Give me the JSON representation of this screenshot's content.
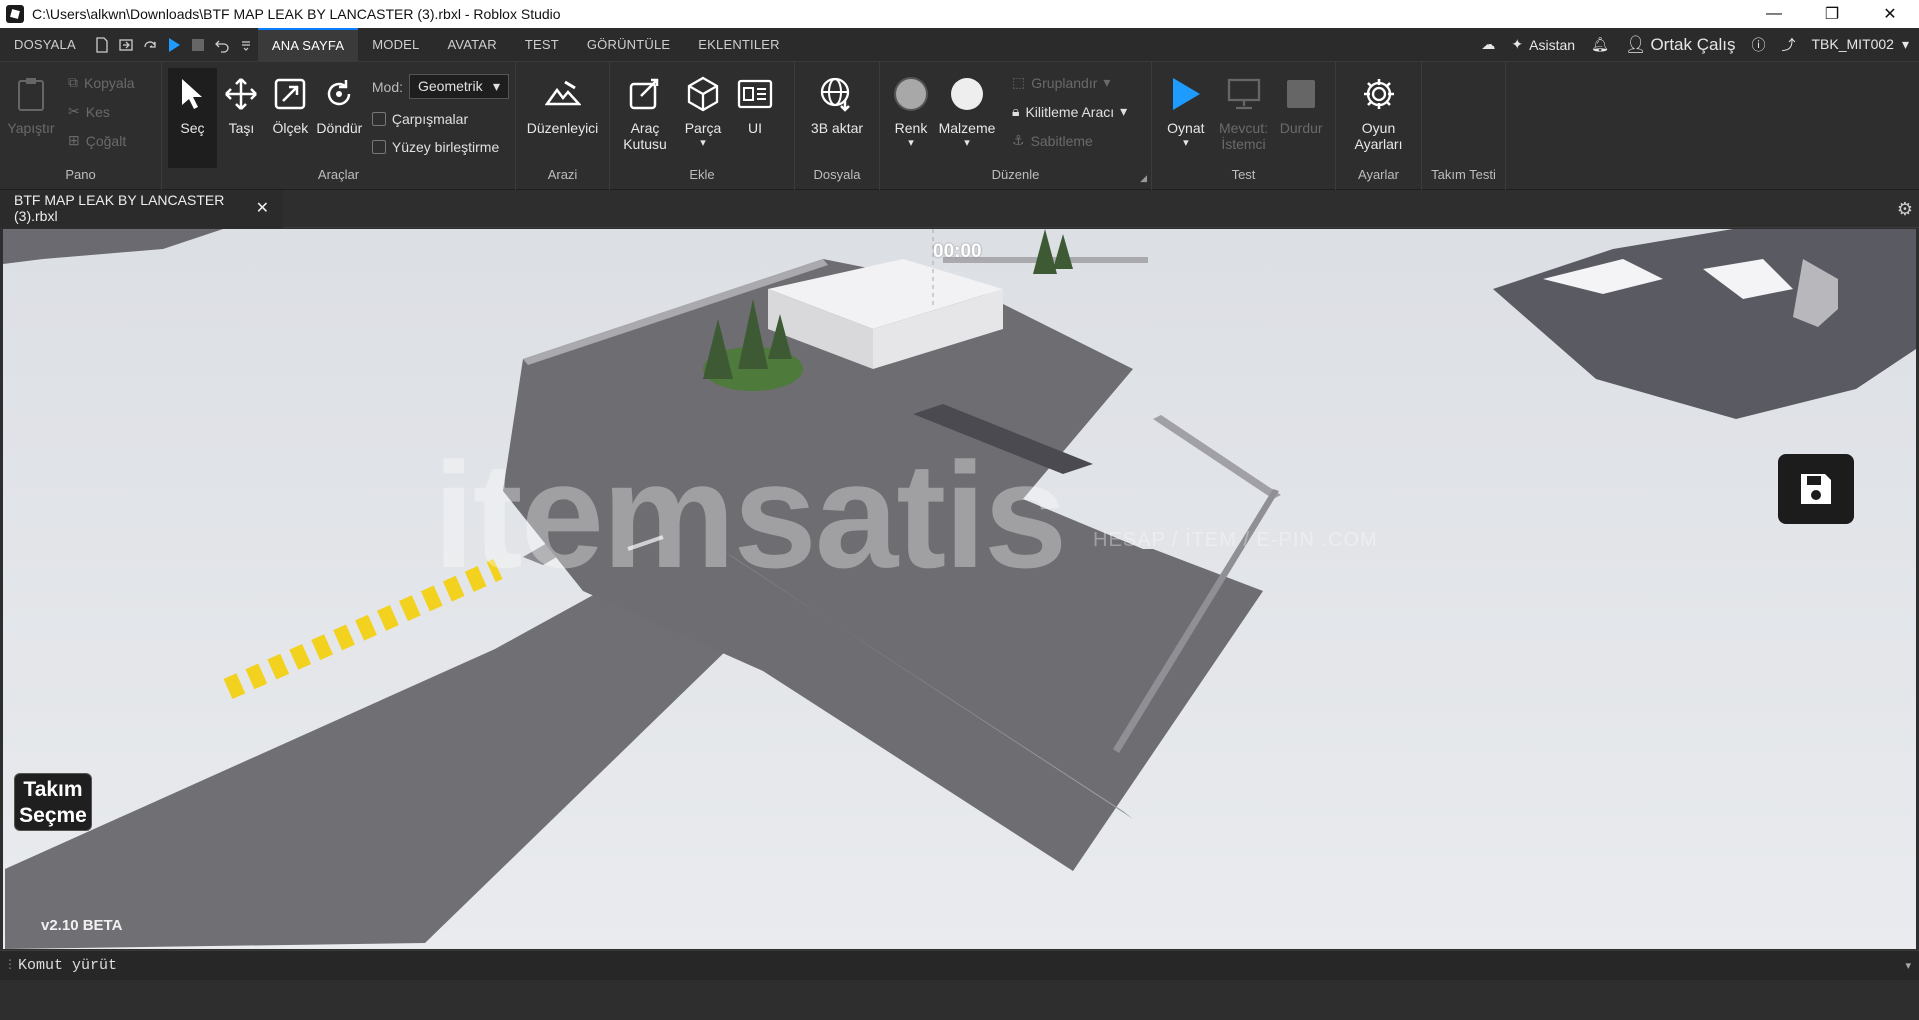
{
  "window": {
    "title": "C:\\Users\\alkwn\\Downloads\\BTF MAP LEAK BY LANCASTER (3).rbxl - Roblox Studio",
    "minimize": "—",
    "maximize": "❐",
    "close": "✕"
  },
  "menubar": {
    "file_label": "DOSYALA",
    "tabs": [
      "ANA SAYFA",
      "MODEL",
      "AVATAR",
      "TEST",
      "GÖRÜNTÜLE",
      "EKLENTILER"
    ],
    "assistant": "Asistan",
    "collab": "Ortak Çalış",
    "user": "TBK_MIT002"
  },
  "ribbon": {
    "clipboard": {
      "paste": "Yapıştır",
      "copy": "Kopyala",
      "cut": "Kes",
      "duplicate": "Çoğalt",
      "label": "Pano"
    },
    "tools": {
      "select": "Seç",
      "move": "Taşı",
      "scale": "Ölçek",
      "rotate": "Döndür",
      "mode_label": "Mod:",
      "mode_value": "Geometrik",
      "collisions": "Çarpışmalar",
      "join_surfaces": "Yüzey birleştirme",
      "label": "Araçlar"
    },
    "terrain": {
      "editor": "Düzenleyici",
      "label": "Arazi"
    },
    "insert": {
      "toolbox_line1": "Araç",
      "toolbox_line2": "Kutusu",
      "part": "Parça",
      "ui": "UI",
      "label": "Ekle"
    },
    "file": {
      "import3d": "3B aktar",
      "label": "Dosyala"
    },
    "edit": {
      "color": "Renk",
      "material": "Malzeme",
      "group": "Gruplandır",
      "lock_tool": "Kilitleme Aracı",
      "anchor": "Sabitleme",
      "label": "Düzenle"
    },
    "test": {
      "play": "Oynat",
      "current_line1": "Mevcut:",
      "current_line2": "İstemci",
      "stop": "Durdur",
      "label": "Test"
    },
    "settings": {
      "game_line1": "Oyun",
      "game_line2": "Ayarları",
      "label": "Ayarlar"
    },
    "team_test": {
      "label": "Takım Testi"
    }
  },
  "doctab": {
    "name": "BTF MAP LEAK BY LANCASTER (3).rbxl",
    "close": "✕"
  },
  "viewport": {
    "timer": "00:00",
    "team_select_line1": "Takım",
    "team_select_line2": "Seçme",
    "version": "v2.10 BETA",
    "watermark": "itemsatis",
    "watermark_sub": "HESAP / İTEM / E-PIN .COM"
  },
  "command_bar": {
    "placeholder": "Komut yürüt"
  },
  "colors": {
    "accent": "#0b7bff",
    "play": "#1e9bff"
  }
}
